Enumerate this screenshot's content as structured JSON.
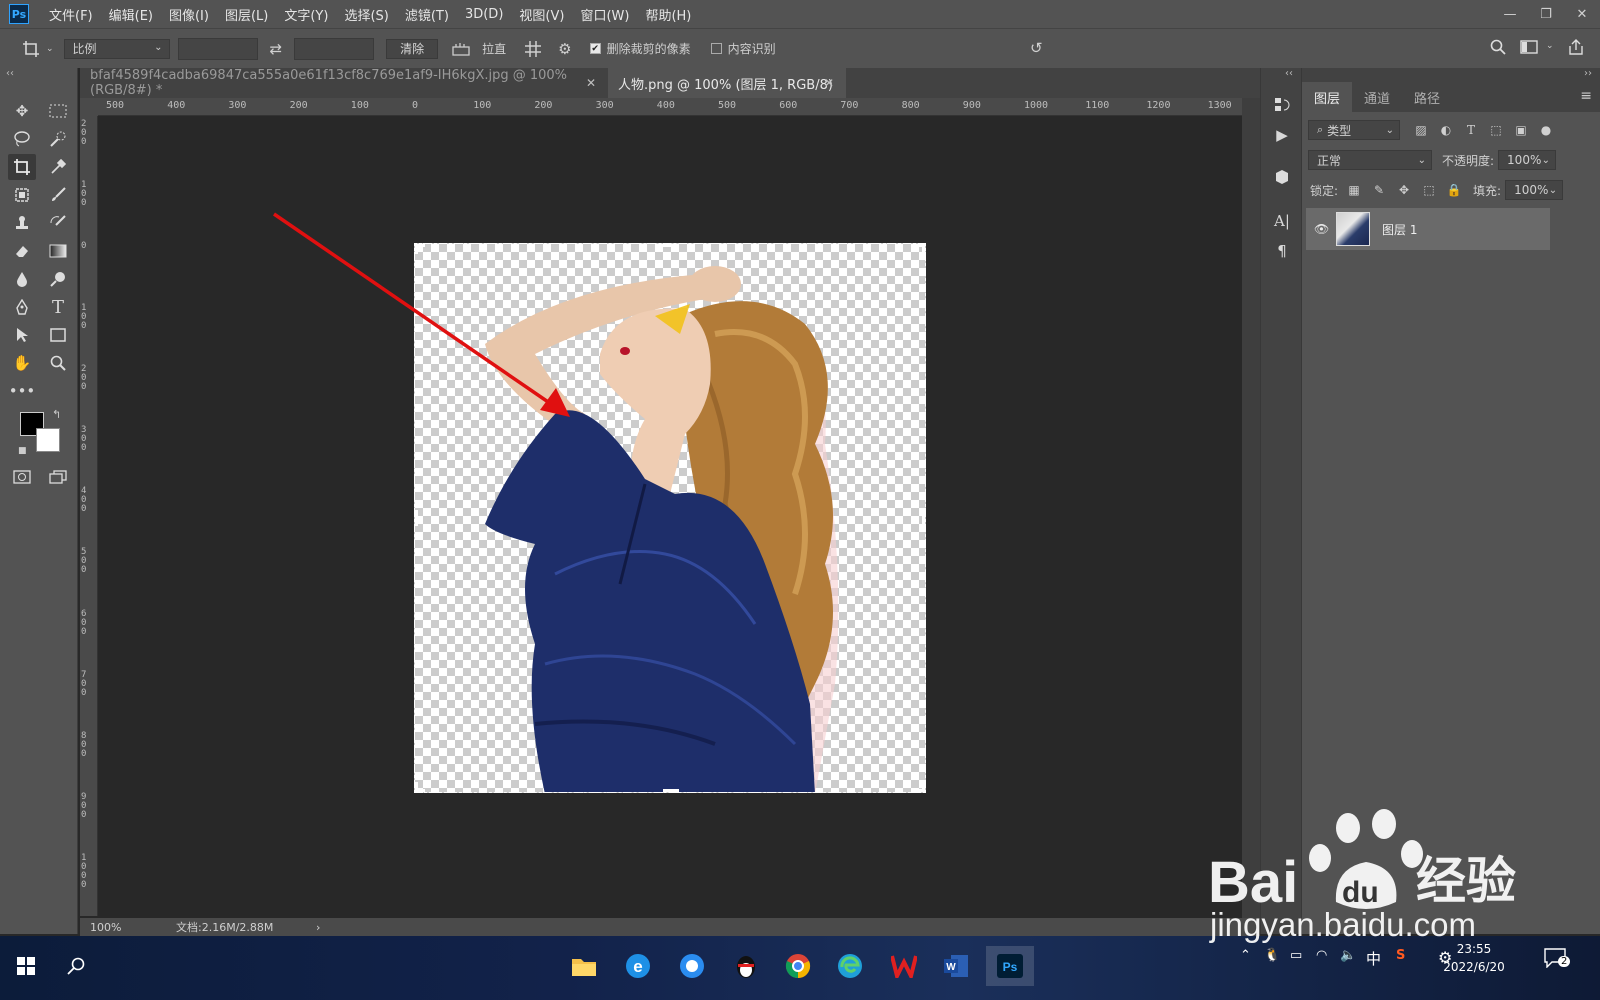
{
  "app": {
    "logo": "Ps",
    "menu": [
      "文件(F)",
      "编辑(E)",
      "图像(I)",
      "图层(L)",
      "文字(Y)",
      "选择(S)",
      "滤镜(T)",
      "3D(D)",
      "视图(V)",
      "窗口(W)",
      "帮助(H)"
    ],
    "window_controls": [
      "—",
      "❐",
      "✕"
    ]
  },
  "options": {
    "ratio_label": "比例",
    "swap_icon": "⇄",
    "clear_label": "清除",
    "straighten_label": "拉直",
    "delete_cropped_label": "删除裁剪的像素",
    "delete_cropped_checked": true,
    "content_aware_label": "内容识别",
    "content_aware_checked": false
  },
  "tabs": [
    {
      "title": "bfaf4589f4cadba69847ca555a0e61f13cf8c769e1af9-IH6kgX.jpg @ 100%(RGB/8#) *",
      "close": "✕"
    },
    {
      "title": "人物.png @ 100% (图层 1, RGB/8)",
      "close": "✕"
    }
  ],
  "ruler": {
    "h_labels": [
      "500",
      "400",
      "300",
      "200",
      "100",
      "0",
      "100",
      "200",
      "300",
      "400",
      "500",
      "600",
      "700",
      "800",
      "900",
      "1000",
      "1100",
      "1200",
      "1300"
    ],
    "v_labels": [
      "200",
      "100",
      "0",
      "100",
      "200",
      "300",
      "400",
      "500",
      "600",
      "700",
      "800",
      "900",
      "1000"
    ]
  },
  "status": {
    "zoom": "100%",
    "doc": "文档:2.16M/2.88M",
    "arrow": "›"
  },
  "layers_panel": {
    "tabs": [
      "图层",
      "通道",
      "路径"
    ],
    "filter_label": "类型",
    "blend_mode": "正常",
    "opacity_label": "不透明度:",
    "opacity_value": "100%",
    "lock_label": "锁定:",
    "fill_label": "填充:",
    "fill_value": "100%",
    "layer_name": "图层 1"
  },
  "taskbar": {
    "ime": "中",
    "time": "23:55",
    "date": "2022/6/20",
    "notification_count": "2"
  },
  "watermark": {
    "brand_left": "Bai",
    "brand_du": "du",
    "brand_right": "经验",
    "url": "jingyan.baidu.com"
  },
  "colors": {
    "accent_ps": "#31a8ff",
    "arrow": "#e01010",
    "dress": "#1e2e6a",
    "hair": "#b8803a"
  }
}
